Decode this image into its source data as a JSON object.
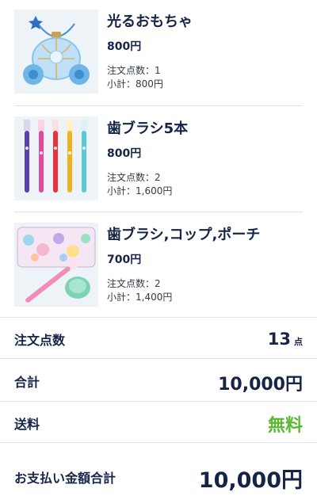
{
  "items": [
    {
      "name": "光るおもちゃ",
      "price": "800円",
      "qty": "注文点数：1",
      "subtotal": "小計：800円"
    },
    {
      "name": "歯ブラシ5本",
      "price": "800円",
      "qty": "注文点数：2",
      "subtotal": "小計：1,600円"
    },
    {
      "name": "歯ブラシ,コップ,ポーチ",
      "price": "700円",
      "qty": "注文点数：2",
      "subtotal": "小計：1,400円"
    }
  ],
  "summary": {
    "count_label": "注文点数",
    "count_value": "13",
    "count_unit": "点",
    "total_label": "合計",
    "total_value": "10,000円",
    "shipping_label": "送料",
    "shipping_value": "無料",
    "grand_label": "お支払い金額合計",
    "grand_value": "10,000円"
  },
  "colors": {
    "text": "#162447",
    "free": "#5bb833",
    "divider": "#e3e3e3"
  }
}
